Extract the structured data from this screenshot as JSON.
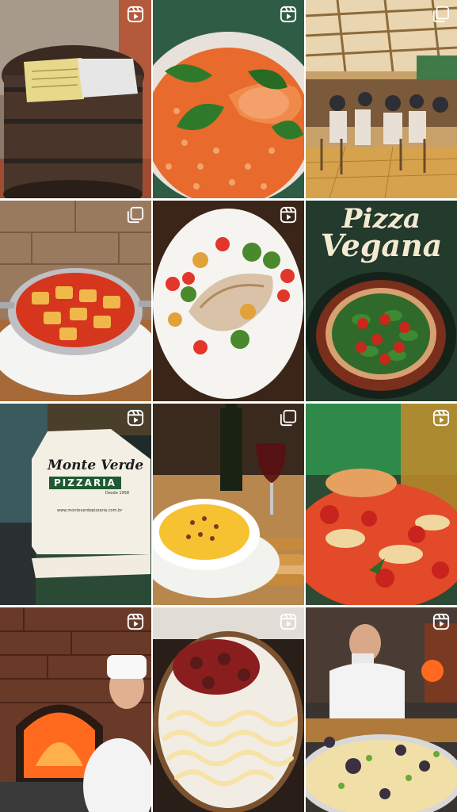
{
  "feed": {
    "posts": [
      {
        "id": "menu-barrel",
        "type": "reel"
      },
      {
        "id": "shrimp-risotto",
        "type": "reel"
      },
      {
        "id": "restaurant-dining-room",
        "type": "carousel"
      },
      {
        "id": "ravioli-pan",
        "type": "carousel"
      },
      {
        "id": "fish-fillet",
        "type": "reel"
      },
      {
        "id": "pizza-vegana",
        "type": "none",
        "title_line1": "Pizza",
        "title_line2": "Vegana"
      },
      {
        "id": "pizza-box",
        "type": "reel",
        "brand": "Monte Verde",
        "sub": "PIZZARIA",
        "since": "Desde 1958",
        "site": "www.monteverdepizzaria.com.br"
      },
      {
        "id": "soup-wine",
        "type": "carousel"
      },
      {
        "id": "pizza-closeup",
        "type": "reel"
      },
      {
        "id": "wood-oven",
        "type": "reel"
      },
      {
        "id": "pizza-ham-cheese",
        "type": "reel"
      },
      {
        "id": "pizzaiolo",
        "type": "reel"
      }
    ]
  },
  "colors": {
    "badge": "#ffffff",
    "brand_green": "#1f5a32",
    "oven_fire": "#ff6a1e",
    "pizza_red": "#d9301c",
    "cream": "#f4ead2"
  }
}
